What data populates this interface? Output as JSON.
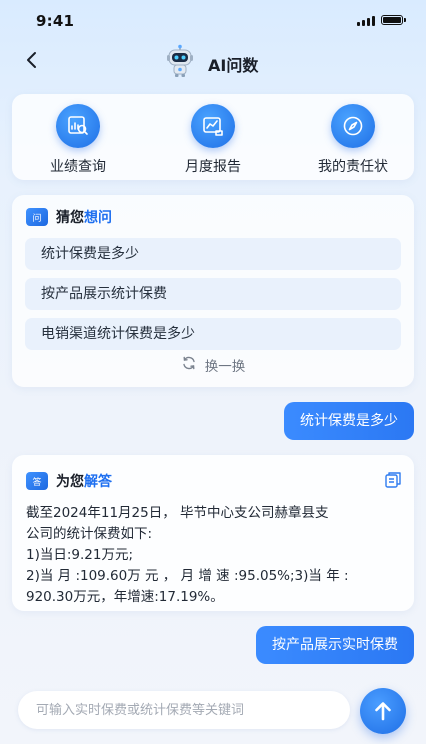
{
  "status_bar": {
    "time": "9:41"
  },
  "header": {
    "title": "AI问数"
  },
  "quick_actions": [
    {
      "label": "业绩查询",
      "icon": "search-chart-icon"
    },
    {
      "label": "月度报告",
      "icon": "monthly-report-icon"
    },
    {
      "label": "我的责任状",
      "icon": "compass-icon"
    }
  ],
  "guess": {
    "title_prefix": "猜您",
    "title_accent": "想问",
    "icon_text": "问",
    "questions": [
      "统计保费是多少",
      "按产品展示统计保费",
      "电销渠道统计保费是多少"
    ],
    "refresh_label": "换一换"
  },
  "chat": {
    "user_message_1": "统计保费是多少",
    "answer_title_prefix": "为您",
    "answer_title_accent": "解答",
    "answer_icon_text": "答",
    "answer_lines": [
      "截至2024年11月25日， 毕节中心支公司赫章县支",
      "公司的统计保费如下:",
      "1)当日:9.21万元;",
      "2)当 月 :109.60万 元 ， 月 增 速 :95.05%;3)当 年 :",
      "920.30万元，年增速:17.19%。"
    ],
    "user_message_2": "按产品展示实时保费"
  },
  "input": {
    "placeholder": "可输入实时保费或统计保费等关键词",
    "value": ""
  },
  "colors": {
    "accent": "#1e6ff0",
    "bubble": "#2b78f3",
    "question_bg": "#e9f1fc"
  }
}
